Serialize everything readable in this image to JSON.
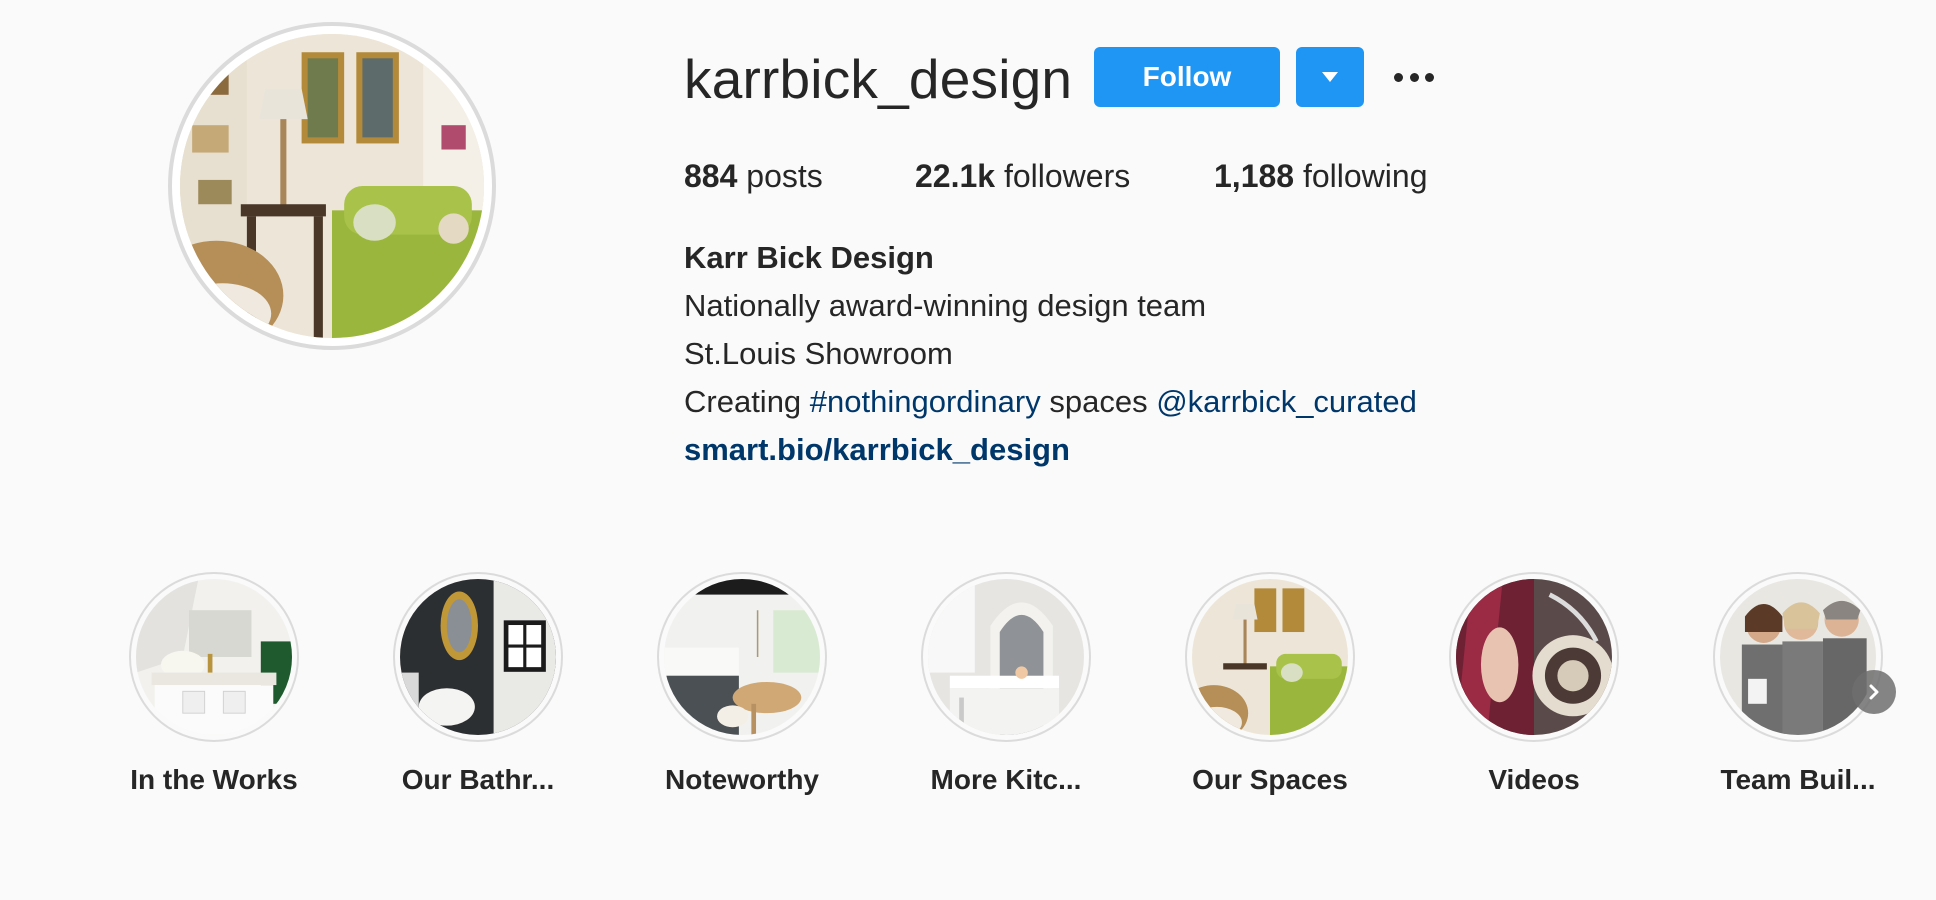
{
  "profile": {
    "username": "karrbick_design",
    "follow_label": "Follow",
    "avatar_icon": "profile-photo-living-room",
    "stats": {
      "posts_count": "884",
      "posts_label": "posts",
      "followers_count": "22.1k",
      "followers_label": "followers",
      "following_count": "1,188",
      "following_label": "following"
    },
    "bio": {
      "name": "Karr Bick Design",
      "line1": "Nationally award-winning design team",
      "line2": "St.Louis Showroom",
      "line3_prefix": "Creating ",
      "hashtag": "#nothingordinary",
      "line3_middle": " spaces ",
      "mention": "@karrbick_curated",
      "website": "smart.bio/karrbick_design"
    }
  },
  "highlights": [
    {
      "label": "In the Works"
    },
    {
      "label": "Our Bathr..."
    },
    {
      "label": "Noteworthy"
    },
    {
      "label": "More Kitc..."
    },
    {
      "label": "Our Spaces"
    },
    {
      "label": "Videos"
    },
    {
      "label": "Team Buil..."
    }
  ],
  "colors": {
    "accent": "#1f95f4",
    "link": "#00376b",
    "text": "#262626",
    "background": "#fafafa"
  },
  "icons": {
    "dropdown": "chevron-down-icon",
    "more": "more-options-icon",
    "next": "chevron-right-icon"
  }
}
